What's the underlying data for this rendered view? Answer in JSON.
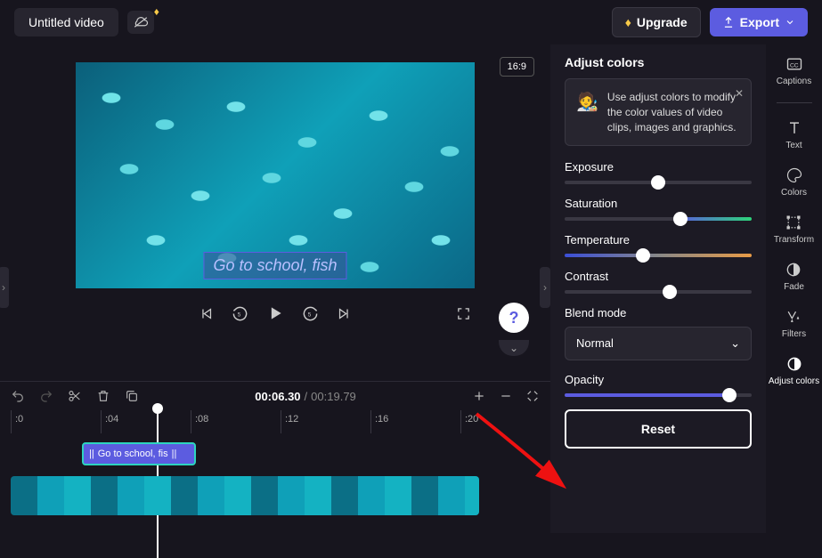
{
  "header": {
    "title": "Untitled video",
    "upgrade": "Upgrade",
    "export": "Export"
  },
  "preview": {
    "aspect_ratio": "16:9",
    "caption_text": "Go to school, fish"
  },
  "timeline": {
    "current_time": "00:06.30",
    "duration": "00:19.79",
    "ticks": [
      ":0",
      ":04",
      ":08",
      ":12",
      ":16",
      ":20"
    ],
    "caption_clip_label": "Go to school, fis"
  },
  "panel": {
    "title": "Adjust colors",
    "tip": "Use adjust colors to modify the color values of video clips, images and graphics.",
    "controls": {
      "exposure": {
        "label": "Exposure",
        "pos_pct": 50
      },
      "saturation": {
        "label": "Saturation",
        "pos_pct": 62
      },
      "temperature": {
        "label": "Temperature",
        "pos_pct": 42
      },
      "contrast": {
        "label": "Contrast",
        "pos_pct": 56
      },
      "blend_mode": {
        "label": "Blend mode",
        "value": "Normal"
      },
      "opacity": {
        "label": "Opacity",
        "pos_pct": 88
      }
    },
    "reset": "Reset"
  },
  "rail": {
    "captions": "Captions",
    "text": "Text",
    "colors": "Colors",
    "transform": "Transform",
    "fade": "Fade",
    "filters": "Filters",
    "adjust_colors": "Adjust colors"
  }
}
